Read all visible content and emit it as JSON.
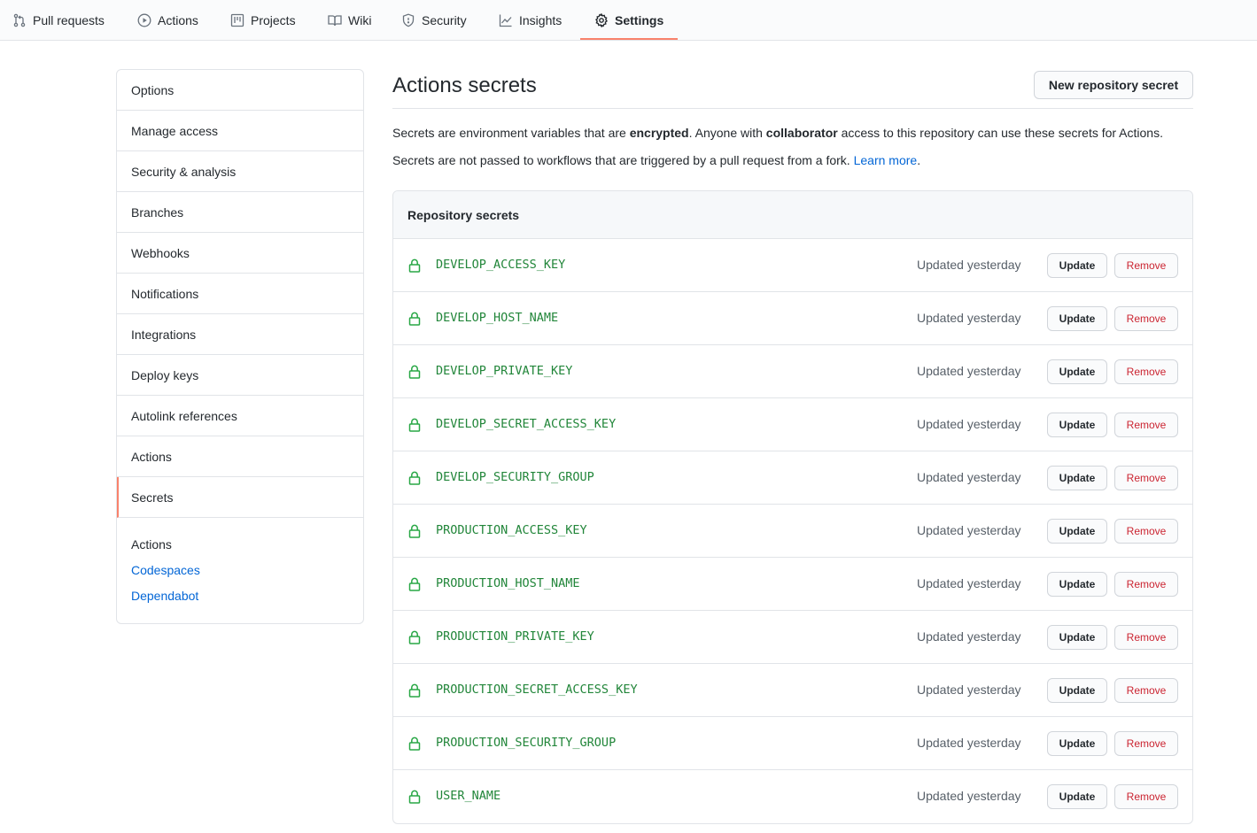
{
  "nav": {
    "tabs": [
      {
        "label": "Pull requests",
        "icon": "pull-request-icon"
      },
      {
        "label": "Actions",
        "icon": "play-icon"
      },
      {
        "label": "Projects",
        "icon": "project-icon"
      },
      {
        "label": "Wiki",
        "icon": "book-icon"
      },
      {
        "label": "Security",
        "icon": "shield-icon"
      },
      {
        "label": "Insights",
        "icon": "graph-icon"
      },
      {
        "label": "Settings",
        "icon": "gear-icon",
        "selected": true
      }
    ],
    "accent_color": "#f9826c"
  },
  "sidebar": {
    "items": [
      {
        "label": "Options"
      },
      {
        "label": "Manage access"
      },
      {
        "label": "Security & analysis"
      },
      {
        "label": "Branches"
      },
      {
        "label": "Webhooks"
      },
      {
        "label": "Notifications"
      },
      {
        "label": "Integrations"
      },
      {
        "label": "Deploy keys"
      },
      {
        "label": "Autolink references"
      },
      {
        "label": "Actions"
      },
      {
        "label": "Secrets",
        "selected": true
      }
    ],
    "sub_heading": "Actions",
    "sub_links": [
      "Codespaces",
      "Dependabot"
    ]
  },
  "main": {
    "title": "Actions secrets",
    "new_button": "New repository secret",
    "desc1": {
      "part1": "Secrets are environment variables that are ",
      "bold1": "encrypted",
      "part2": ". Anyone with ",
      "bold2": "collaborator",
      "part3": " access to this repository can use these secrets for Actions."
    },
    "desc2": {
      "text": "Secrets are not passed to workflows that are triggered by a pull request from a fork. ",
      "link": "Learn more",
      "end": "."
    },
    "box_title": "Repository secrets",
    "update_label": "Update",
    "remove_label": "Remove",
    "secrets": [
      {
        "name": "DEVELOP_ACCESS_KEY",
        "updated": "Updated yesterday"
      },
      {
        "name": "DEVELOP_HOST_NAME",
        "updated": "Updated yesterday"
      },
      {
        "name": "DEVELOP_PRIVATE_KEY",
        "updated": "Updated yesterday"
      },
      {
        "name": "DEVELOP_SECRET_ACCESS_KEY",
        "updated": "Updated yesterday"
      },
      {
        "name": "DEVELOP_SECURITY_GROUP",
        "updated": "Updated yesterday"
      },
      {
        "name": "PRODUCTION_ACCESS_KEY",
        "updated": "Updated yesterday"
      },
      {
        "name": "PRODUCTION_HOST_NAME",
        "updated": "Updated yesterday"
      },
      {
        "name": "PRODUCTION_PRIVATE_KEY",
        "updated": "Updated yesterday"
      },
      {
        "name": "PRODUCTION_SECRET_ACCESS_KEY",
        "updated": "Updated yesterday"
      },
      {
        "name": "PRODUCTION_SECURITY_GROUP",
        "updated": "Updated yesterday"
      },
      {
        "name": "USER_NAME",
        "updated": "Updated yesterday"
      }
    ]
  }
}
